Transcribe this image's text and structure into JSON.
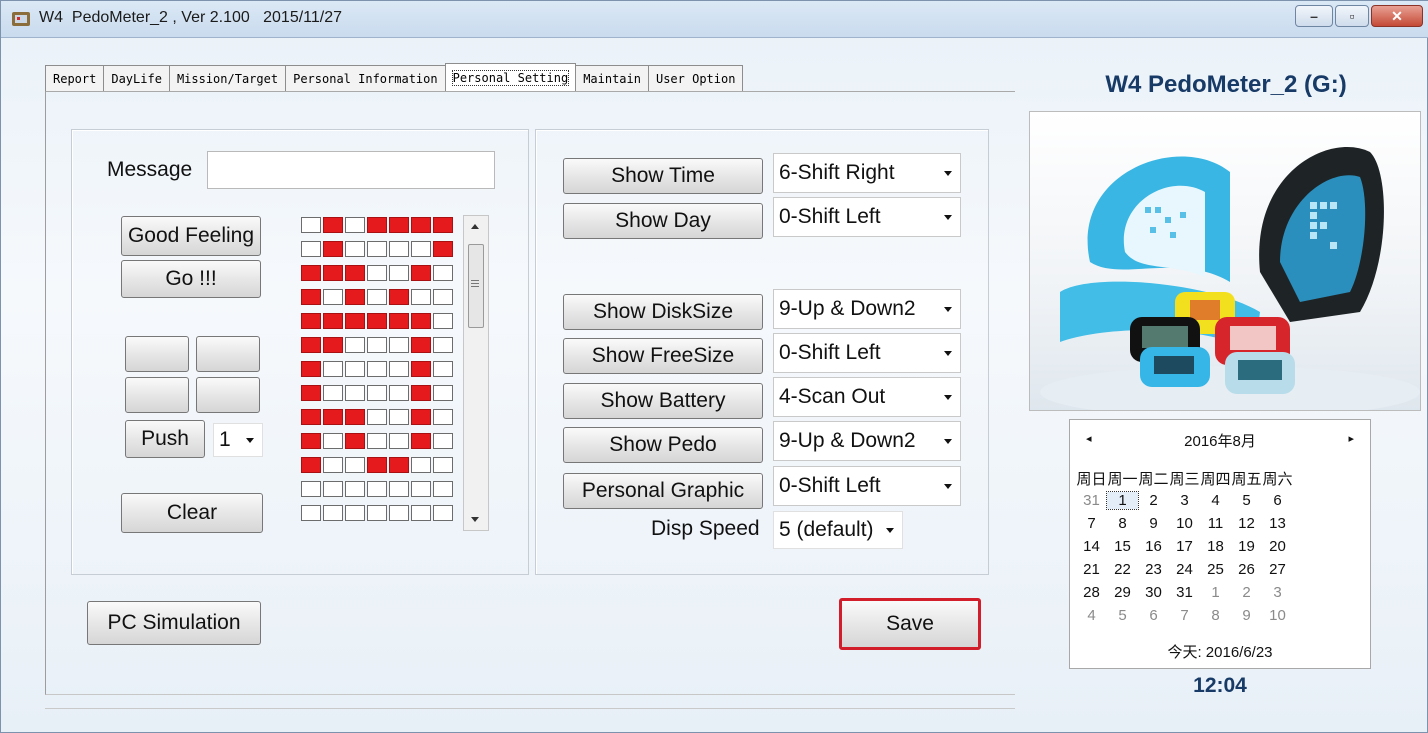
{
  "window": {
    "title": "W4  PedoMeter_2 , Ver 2.100   2015/11/27",
    "controls": {
      "minimize": "–",
      "maximize": "▫",
      "close": "✕"
    }
  },
  "tabs": [
    {
      "label": "Report",
      "active": false
    },
    {
      "label": "DayLife",
      "active": false
    },
    {
      "label": "Mission/Target",
      "active": false
    },
    {
      "label": "Personal Information",
      "active": false
    },
    {
      "label": "Personal Setting",
      "active": true
    },
    {
      "label": "Maintain",
      "active": false
    },
    {
      "label": "User Option",
      "active": false
    }
  ],
  "left": {
    "message_label": "Message",
    "message_value": "",
    "good_feeling": "Good Feeling",
    "go": "Go !!!",
    "blank_buttons": [
      "",
      "",
      "",
      ""
    ],
    "push": "Push",
    "push_value": "1",
    "clear": "Clear",
    "pc_simulation": "PC Simulation"
  },
  "matrix": {
    "rows": [
      [
        0,
        1,
        0,
        1,
        1,
        1,
        1
      ],
      [
        0,
        1,
        0,
        0,
        0,
        0,
        1
      ],
      [
        1,
        1,
        1,
        0,
        0,
        1,
        0
      ],
      [
        1,
        0,
        1,
        0,
        1,
        0,
        0
      ],
      [
        1,
        1,
        1,
        1,
        1,
        1,
        0
      ],
      [
        1,
        1,
        0,
        0,
        0,
        1,
        0
      ],
      [
        1,
        0,
        0,
        0,
        0,
        1,
        0
      ],
      [
        1,
        0,
        0,
        0,
        0,
        1,
        0
      ],
      [
        1,
        1,
        1,
        0,
        0,
        1,
        0
      ],
      [
        1,
        0,
        1,
        0,
        0,
        1,
        0
      ],
      [
        1,
        0,
        0,
        1,
        1,
        0,
        0
      ],
      [
        0,
        0,
        0,
        0,
        0,
        0,
        0
      ],
      [
        0,
        0,
        0,
        0,
        0,
        0,
        0
      ]
    ]
  },
  "settings": [
    {
      "button": "Show Time",
      "value": "6-Shift Right"
    },
    {
      "button": "Show Day",
      "value": "0-Shift Left"
    },
    {
      "button": "Show DiskSize",
      "value": "9-Up & Down2"
    },
    {
      "button": "Show FreeSize",
      "value": "0-Shift Left"
    },
    {
      "button": "Show Battery",
      "value": "4-Scan Out"
    },
    {
      "button": "Show Pedo",
      "value": "9-Up & Down2"
    },
    {
      "button": "Personal Graphic",
      "value": "0-Shift Left"
    }
  ],
  "disp_speed": {
    "label": "Disp Speed",
    "value": "5 (default)"
  },
  "save": "Save",
  "right": {
    "device_title": "W4  PedoMeter_2  (G:)",
    "calendar": {
      "month": "2016年8月",
      "prev": "◂",
      "next": "▸",
      "dow": [
        "周日",
        "周一",
        "周二",
        "周三",
        "周四",
        "周五",
        "周六"
      ],
      "weeks": [
        [
          "31",
          "1",
          "2",
          "3",
          "4",
          "5",
          "6"
        ],
        [
          "7",
          "8",
          "9",
          "10",
          "11",
          "12",
          "13"
        ],
        [
          "14",
          "15",
          "16",
          "17",
          "18",
          "19",
          "20"
        ],
        [
          "21",
          "22",
          "23",
          "24",
          "25",
          "26",
          "27"
        ],
        [
          "28",
          "29",
          "30",
          "31",
          "1",
          "2",
          "3"
        ],
        [
          "4",
          "5",
          "6",
          "7",
          "8",
          "9",
          "10"
        ]
      ],
      "today": "今天: 2016/6/23"
    },
    "clock": "12:04"
  }
}
